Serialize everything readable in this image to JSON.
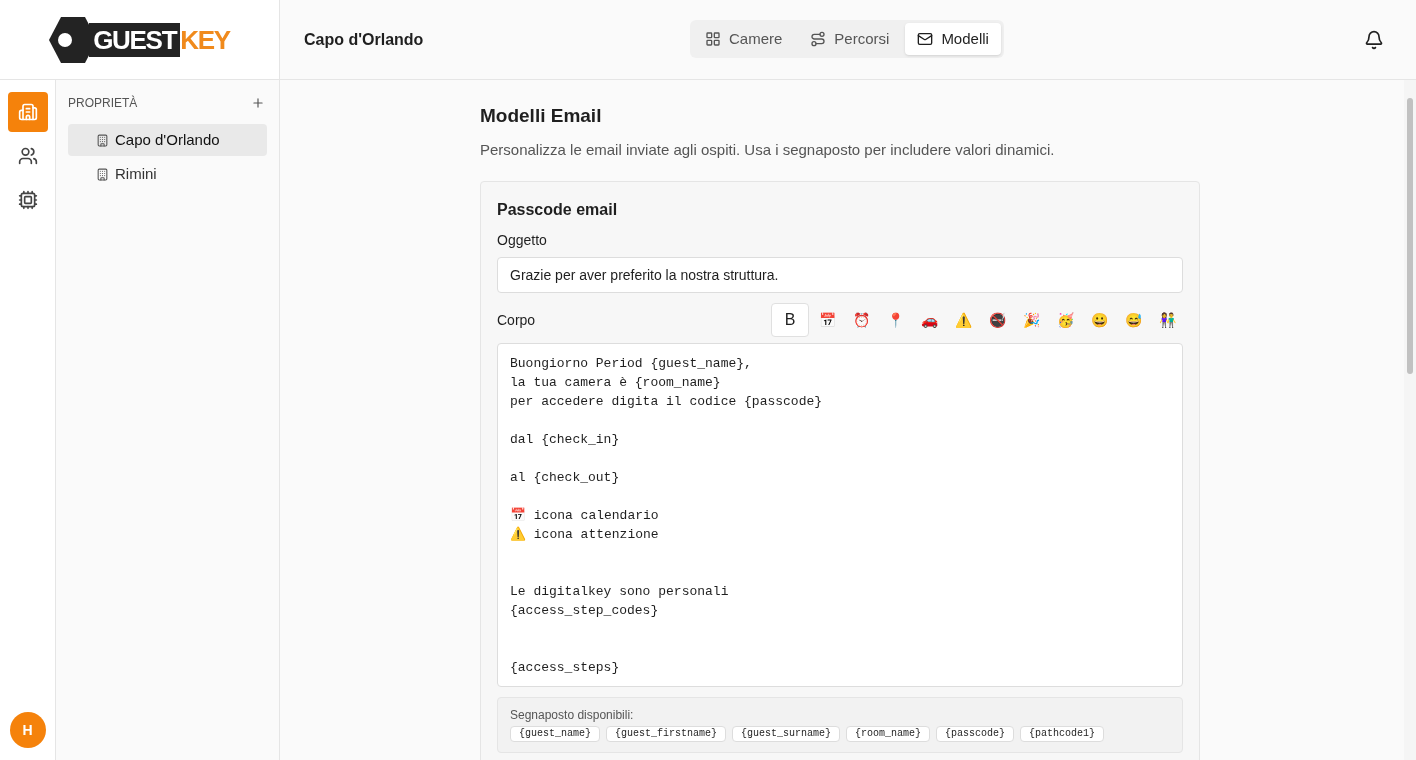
{
  "logo": {
    "part1": "GUEST",
    "part2": "KEY"
  },
  "header": {
    "title": "Capo d'Orlando",
    "tabs": [
      {
        "label": "Camere",
        "selected": false
      },
      {
        "label": "Percorsi",
        "selected": false
      },
      {
        "label": "Modelli",
        "selected": true
      }
    ]
  },
  "rail": [
    {
      "selected": true
    },
    {
      "selected": false
    },
    {
      "selected": false
    }
  ],
  "avatar": "H",
  "sidebar": {
    "heading": "PROPRIETÀ",
    "items": [
      {
        "label": "Capo d'Orlando",
        "selected": true
      },
      {
        "label": "Rimini",
        "selected": false
      }
    ]
  },
  "page": {
    "title": "Modelli Email",
    "subtitle": "Personalizza le email inviate agli ospiti. Usa i segnaposto per includere valori dinamici."
  },
  "template": {
    "title": "Passcode email",
    "subject_label": "Oggetto",
    "subject": "Grazie per aver preferito la nostra struttura.",
    "body_label": "Corpo",
    "toolbar": [
      "B",
      "📅",
      "⏰",
      "📍",
      "🚗",
      "⚠️",
      "🚭",
      "🎉",
      "🥳",
      "😀",
      "😅",
      "👫"
    ],
    "body": "Buongiorno Period {guest_name},\nla tua camera è {room_name}\nper accedere digita il codice {passcode}\n\ndal {check_in}\n\nal {check_out}\n\n📅 icona calendario\n⚠️ icona attenzione\n\n\nLe digitalkey sono personali\n{access_step_codes}\n\n\n{access_steps}",
    "placeholders_label": "Segnaposto disponibili:",
    "placeholders": [
      "{guest_name}",
      "{guest_firstname}",
      "{guest_surname}",
      "{room_name}",
      "{passcode}",
      "{pathcode1}"
    ]
  }
}
